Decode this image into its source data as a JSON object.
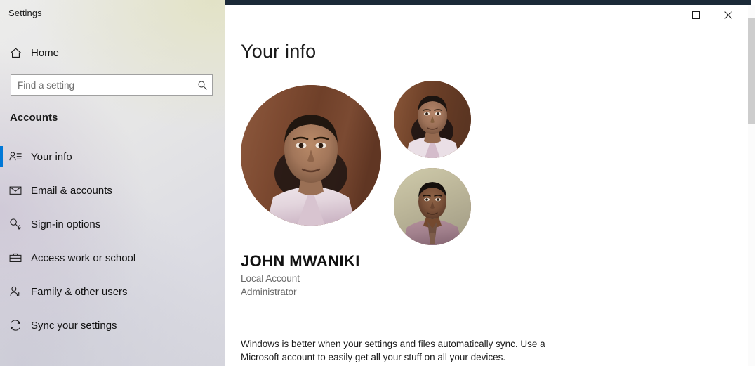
{
  "window": {
    "title": "Settings",
    "controls": {
      "minimize": "minimize-button",
      "maximize": "maximize-button",
      "close": "close-button"
    }
  },
  "sidebar": {
    "home_label": "Home",
    "home_icon": "home-icon",
    "search": {
      "placeholder": "Find a setting",
      "value": "",
      "icon": "search-icon"
    },
    "section_header": "Accounts",
    "items": [
      {
        "label": "Your info",
        "icon": "user-info-icon",
        "selected": true
      },
      {
        "label": "Email & accounts",
        "icon": "envelope-icon",
        "selected": false
      },
      {
        "label": "Sign-in options",
        "icon": "key-icon",
        "selected": false
      },
      {
        "label": "Access work or school",
        "icon": "briefcase-icon",
        "selected": false
      },
      {
        "label": "Family & other users",
        "icon": "user-add-icon",
        "selected": false
      },
      {
        "label": "Sync your settings",
        "icon": "sync-refresh-icon",
        "selected": false
      }
    ]
  },
  "main": {
    "page_title": "Your info",
    "account": {
      "name": "JOHN MWANIKI",
      "account_type": "Local Account",
      "role": "Administrator"
    },
    "avatars": [
      {
        "name": "current-profile-picture",
        "size": "large"
      },
      {
        "name": "recent-profile-picture-1",
        "size": "small"
      },
      {
        "name": "recent-profile-picture-2",
        "size": "small"
      }
    ],
    "sync_description": "Windows is better when your settings and files automatically sync. Use a Microsoft account to easily get all your stuff on all your devices."
  },
  "colors": {
    "accent": "#0078d7",
    "titlebar": "#1b2a38",
    "sidebar_base": "#e3e3e4",
    "text_primary": "#1a1a1a",
    "text_secondary": "#6a6a6a"
  }
}
